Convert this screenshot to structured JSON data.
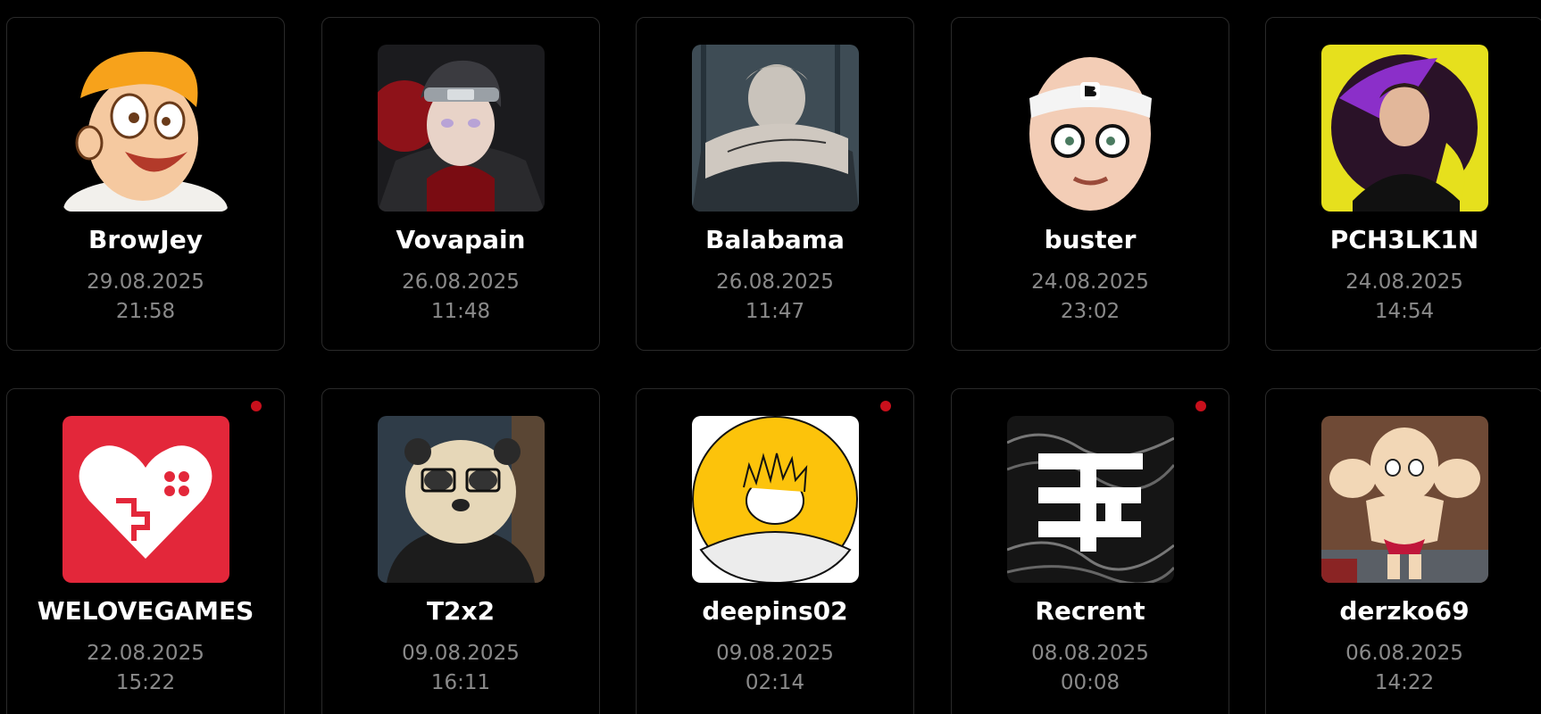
{
  "colors": {
    "background": "#000000",
    "card_border": "#2a2a2a",
    "name": "#ffffff",
    "meta": "#8a8a8a",
    "live_dot": "#c8101c"
  },
  "cards": [
    {
      "name": "BrowJey",
      "date": "29.08.2025",
      "time": "21:58",
      "live": false
    },
    {
      "name": "Vovapain",
      "date": "26.08.2025",
      "time": "11:48",
      "live": false
    },
    {
      "name": "Balabama",
      "date": "26.08.2025",
      "time": "11:47",
      "live": false
    },
    {
      "name": "buster",
      "date": "24.08.2025",
      "time": "23:02",
      "live": false
    },
    {
      "name": "PCH3LK1N",
      "date": "24.08.2025",
      "time": "14:54",
      "live": false
    },
    {
      "name": "WELOVEGAMES",
      "date": "22.08.2025",
      "time": "15:22",
      "live": true
    },
    {
      "name": "T2x2",
      "date": "09.08.2025",
      "time": "16:11",
      "live": false
    },
    {
      "name": "deepins02",
      "date": "09.08.2025",
      "time": "02:14",
      "live": true
    },
    {
      "name": "Recrent",
      "date": "08.08.2025",
      "time": "00:08",
      "live": true
    },
    {
      "name": "derzko69",
      "date": "06.08.2025",
      "time": "14:22",
      "live": false
    }
  ]
}
